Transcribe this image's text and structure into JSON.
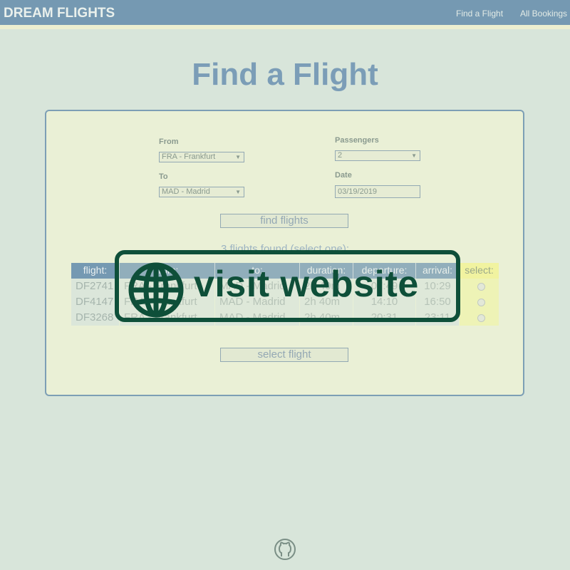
{
  "header": {
    "brand": "DREAM FLIGHTS",
    "nav": {
      "find_flight": "Find a Flight",
      "all_bookings": "All Bookings"
    }
  },
  "page": {
    "title": "Find a Flight"
  },
  "form": {
    "from_label": "From",
    "from_value": "FRA - Frankfurt",
    "to_label": "To",
    "to_value": "MAD - Madrid",
    "passengers_label": "Passengers",
    "passengers_value": "2",
    "date_label": "Date",
    "date_value": "03/19/2019",
    "find_button": "find flights"
  },
  "results": {
    "summary": "3 flights found (select one):",
    "columns": [
      "flight:",
      "from:",
      "to:",
      "duration:",
      "departure:",
      "arrival:",
      "select:"
    ],
    "rows": [
      {
        "flight": "DF2741",
        "from": "FRA - Frankfurt",
        "to": "MAD - Madrid",
        "duration": "2h 40m",
        "departure": "07:49",
        "arrival": "10:29"
      },
      {
        "flight": "DF4147",
        "from": "FRA - Frankfurt",
        "to": "MAD - Madrid",
        "duration": "2h 40m",
        "departure": "14:10",
        "arrival": "16:50"
      },
      {
        "flight": "DF3268",
        "from": "FRA - Frankfurt",
        "to": "MAD - Madrid",
        "duration": "2h 40m",
        "departure": "20:31",
        "arrival": "23:11"
      }
    ],
    "select_button": "select flight"
  },
  "overlay": {
    "label": "visit website",
    "icon": "globe-icon"
  },
  "footer": {
    "icon": "github-icon"
  },
  "colors": {
    "header": "#7599b2",
    "accent": "#0e4f39",
    "select_col": "#f1f3a0"
  }
}
